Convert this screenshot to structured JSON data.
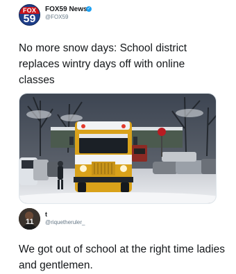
{
  "tweet": {
    "avatar_band": "FOX",
    "avatar_number": "59",
    "name": "FOX59 News",
    "verified_glyph": "✓",
    "handle": "@FOX59",
    "text": "No more snow days: School district replaces wintry days off with online classes",
    "photo_sign": "STOP"
  },
  "reply": {
    "avatar_number": "11",
    "name": "t",
    "handle": "@riquetheruler_",
    "text": "We got out of school at the right time ladies and gentlemen."
  },
  "colors": {
    "fox_red": "#c9141b",
    "fox_blue": "#1f3f8a",
    "verified_blue": "#1da1f2",
    "bus_yellow": "#e0a81c"
  }
}
